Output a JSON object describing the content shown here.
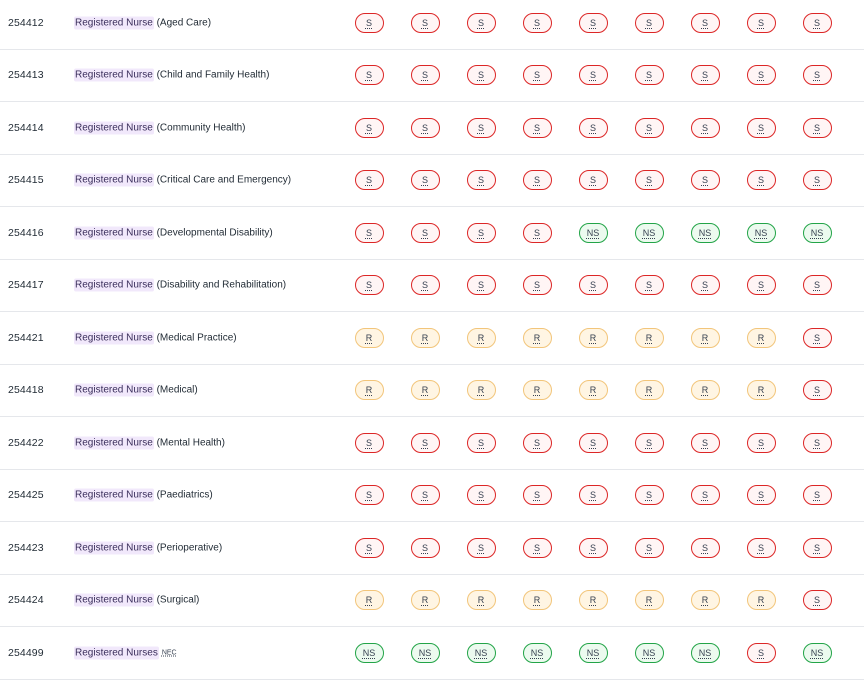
{
  "rows": [
    {
      "code": "254412",
      "title": "Registered Nurse",
      "specialty": "(Aged Care)",
      "suffix": "",
      "statuses": [
        "S",
        "S",
        "S",
        "S",
        "S",
        "S",
        "S",
        "S",
        "S"
      ]
    },
    {
      "code": "254413",
      "title": "Registered Nurse",
      "specialty": "(Child and Family Health)",
      "suffix": "",
      "statuses": [
        "S",
        "S",
        "S",
        "S",
        "S",
        "S",
        "S",
        "S",
        "S"
      ]
    },
    {
      "code": "254414",
      "title": "Registered Nurse",
      "specialty": "(Community Health)",
      "suffix": "",
      "statuses": [
        "S",
        "S",
        "S",
        "S",
        "S",
        "S",
        "S",
        "S",
        "S"
      ]
    },
    {
      "code": "254415",
      "title": "Registered Nurse",
      "specialty": "(Critical Care and Emergency)",
      "suffix": "",
      "statuses": [
        "S",
        "S",
        "S",
        "S",
        "S",
        "S",
        "S",
        "S",
        "S"
      ]
    },
    {
      "code": "254416",
      "title": "Registered Nurse",
      "specialty": "(Developmental Disability)",
      "suffix": "",
      "statuses": [
        "S",
        "S",
        "S",
        "S",
        "NS",
        "NS",
        "NS",
        "NS",
        "NS"
      ]
    },
    {
      "code": "254417",
      "title": "Registered Nurse",
      "specialty": "(Disability and Rehabilitation)",
      "suffix": "",
      "statuses": [
        "S",
        "S",
        "S",
        "S",
        "S",
        "S",
        "S",
        "S",
        "S"
      ]
    },
    {
      "code": "254421",
      "title": "Registered Nurse",
      "specialty": "(Medical Practice)",
      "suffix": "",
      "statuses": [
        "R",
        "R",
        "R",
        "R",
        "R",
        "R",
        "R",
        "R",
        "S"
      ]
    },
    {
      "code": "254418",
      "title": "Registered Nurse",
      "specialty": "(Medical)",
      "suffix": "",
      "statuses": [
        "R",
        "R",
        "R",
        "R",
        "R",
        "R",
        "R",
        "R",
        "S"
      ]
    },
    {
      "code": "254422",
      "title": "Registered Nurse",
      "specialty": "(Mental Health)",
      "suffix": "",
      "statuses": [
        "S",
        "S",
        "S",
        "S",
        "S",
        "S",
        "S",
        "S",
        "S"
      ]
    },
    {
      "code": "254425",
      "title": "Registered Nurse",
      "specialty": "(Paediatrics)",
      "suffix": "",
      "statuses": [
        "S",
        "S",
        "S",
        "S",
        "S",
        "S",
        "S",
        "S",
        "S"
      ]
    },
    {
      "code": "254423",
      "title": "Registered Nurse",
      "specialty": "(Perioperative)",
      "suffix": "",
      "statuses": [
        "S",
        "S",
        "S",
        "S",
        "S",
        "S",
        "S",
        "S",
        "S"
      ]
    },
    {
      "code": "254424",
      "title": "Registered Nurse",
      "specialty": "(Surgical)",
      "suffix": "",
      "statuses": [
        "R",
        "R",
        "R",
        "R",
        "R",
        "R",
        "R",
        "R",
        "S"
      ]
    },
    {
      "code": "254499",
      "title": "Registered Nurses",
      "specialty": "",
      "suffix": "NEC",
      "statuses": [
        "NS",
        "NS",
        "NS",
        "NS",
        "NS",
        "NS",
        "NS",
        "S",
        "NS"
      ]
    }
  ],
  "status_colors": {
    "S": "#dc2626",
    "R": "#f2c57a",
    "NS": "#22a447"
  }
}
